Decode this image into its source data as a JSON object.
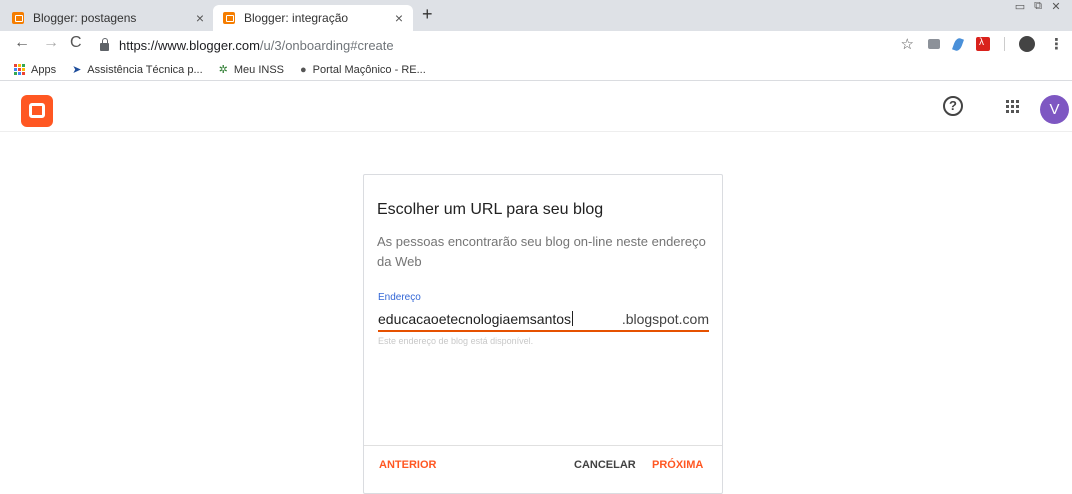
{
  "browser": {
    "tabs": [
      {
        "label": "Blogger: postagens"
      },
      {
        "label": "Blogger: integração"
      }
    ],
    "url_host": "https://www.blogger.com",
    "url_path": "/u/3/onboarding#create",
    "bookmarks": [
      {
        "label": "Apps"
      },
      {
        "label": "Assistência Técnica p..."
      },
      {
        "label": "Meu INSS"
      },
      {
        "label": "Portal Maçônico - RE..."
      }
    ]
  },
  "header": {
    "avatar_letter": "V"
  },
  "dialog": {
    "title": "Escolher um URL para seu blog",
    "subtitle": "As pessoas encontrarão seu blog on-line neste endereço da Web",
    "field_label": "Endereço",
    "field_value": "educacaoetecnologiaemsantos",
    "field_suffix": ".blogspot.com",
    "helper": "Este endereço de blog está disponível.",
    "prev_label": "ANTERIOR",
    "cancel_label": "CANCELAR",
    "next_label": "PRÓXIMA"
  },
  "colors": {
    "accent": "#ff5722",
    "link_blue": "#3367d6",
    "avatar": "#7e57c2"
  },
  "icons": [
    "blogger-logo",
    "help-icon",
    "apps-grid-icon",
    "star-icon",
    "lock-icon"
  ]
}
